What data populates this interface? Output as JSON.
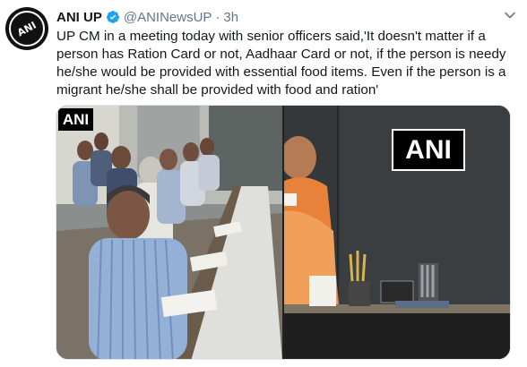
{
  "tweet": {
    "author_name": "ANI UP",
    "handle": "@ANINewsUP",
    "separator": "·",
    "time": "3h",
    "text": "UP CM in a meeting today with senior officers said,'It doesn't matter if a person has Ration Card or not, Aadhaar Card or not, if the person is needy he/she would be provided with essential food items. Even if the person is a migrant he/she shall be provided with food and ration'",
    "avatar_label": "ANI",
    "verified": true
  },
  "media": {
    "photo1_logo": "ANI",
    "photo2_logo": "ANI"
  },
  "colors": {
    "name": "#14171a",
    "secondary": "#657786",
    "verified": "#1da1f2"
  },
  "icons": {
    "verified": "verified-badge-icon",
    "more": "chevron-down-icon"
  }
}
